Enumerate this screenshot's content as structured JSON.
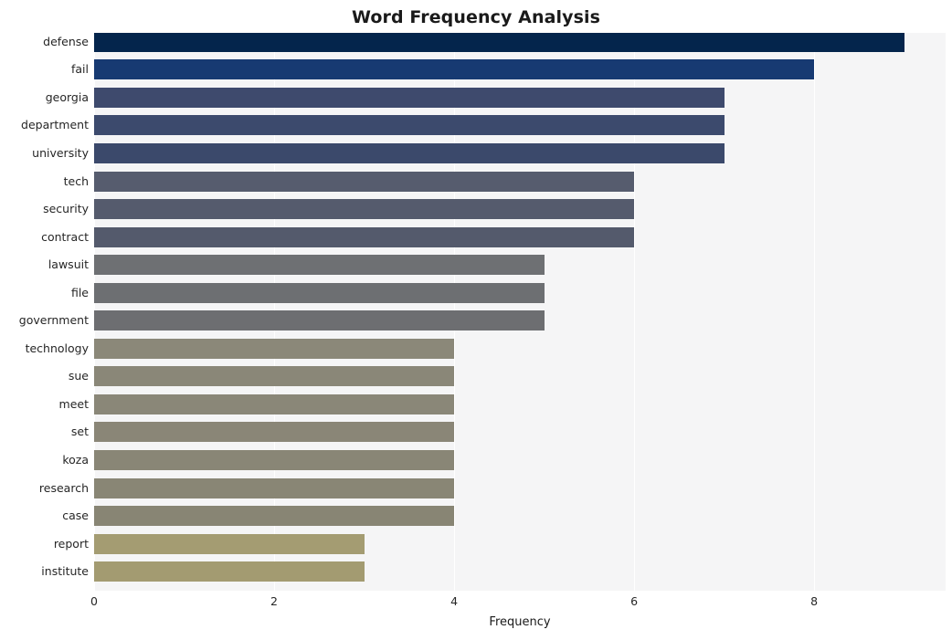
{
  "chart_data": {
    "type": "bar",
    "orientation": "horizontal",
    "title": "Word Frequency Analysis",
    "xlabel": "Frequency",
    "ylabel": "",
    "categories": [
      "defense",
      "fail",
      "georgia",
      "department",
      "university",
      "tech",
      "security",
      "contract",
      "lawsuit",
      "file",
      "government",
      "technology",
      "sue",
      "meet",
      "set",
      "koza",
      "research",
      "case",
      "report",
      "institute"
    ],
    "values": [
      9,
      8,
      7,
      7,
      7,
      6,
      6,
      6,
      5,
      5,
      5,
      4,
      4,
      4,
      4,
      4,
      4,
      4,
      3,
      3
    ],
    "bar_colors": [
      "#04254c",
      "#173a72",
      "#3e4a6d",
      "#3c4a6d",
      "#3b496b",
      "#565c6e",
      "#555b6d",
      "#545a6c",
      "#6e7073",
      "#6d6f72",
      "#6d6e71",
      "#8b8879",
      "#8a8778",
      "#8a8778",
      "#8a8677",
      "#898676",
      "#898675",
      "#888574",
      "#a49c72",
      "#a39b71"
    ],
    "xlim": [
      0,
      9.46
    ],
    "xticks": [
      0,
      2,
      4,
      6,
      8
    ],
    "xtick_labels": [
      "0",
      "2",
      "4",
      "6",
      "8"
    ],
    "grid": "vertical-only",
    "grid_color": "#ffffff",
    "plot_background": "#f5f5f6",
    "figure_background": "#ffffff",
    "legend": "none"
  }
}
